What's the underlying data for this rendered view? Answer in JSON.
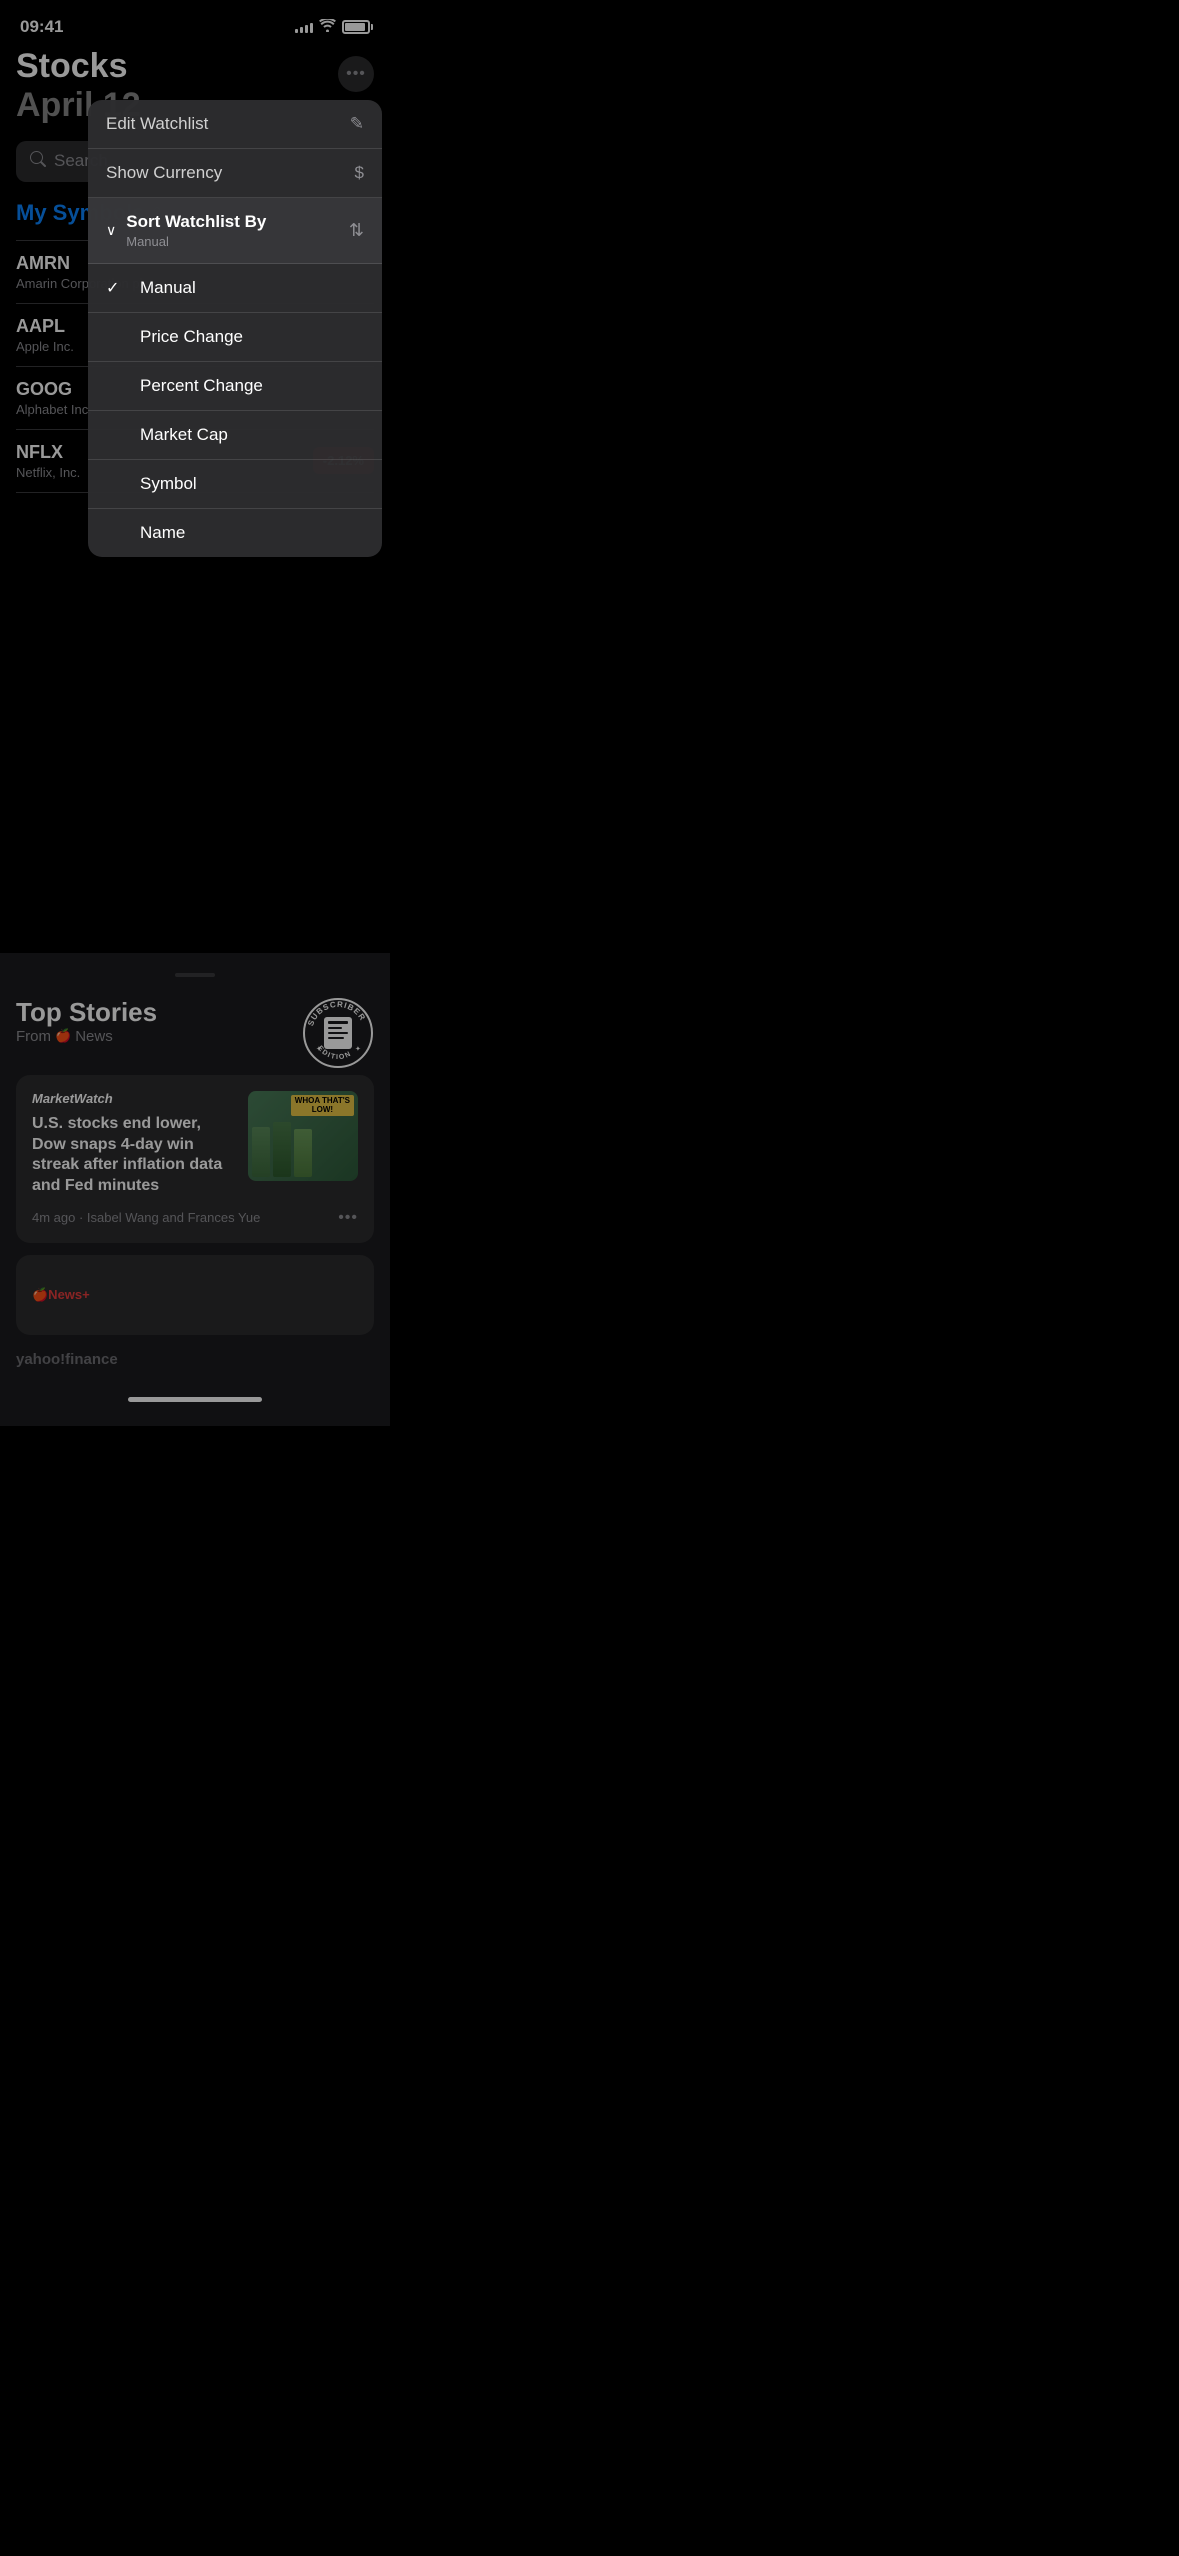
{
  "statusBar": {
    "time": "09:41",
    "signalBars": [
      4,
      6,
      8,
      10,
      12
    ],
    "batteryLevel": 90
  },
  "header": {
    "appTitle": "Stocks",
    "date": "April 12",
    "moreButtonLabel": "•••"
  },
  "search": {
    "placeholder": "Search"
  },
  "watchlist": {
    "label": "My Symbols",
    "stocks": [
      {
        "symbol": "AMRN",
        "name": "Amarin Corporation plc"
      },
      {
        "symbol": "AAPL",
        "name": "Apple Inc."
      },
      {
        "symbol": "GOOG",
        "name": "Alphabet Inc."
      },
      {
        "symbol": "NFLX",
        "name": "Netflix, Inc.",
        "badge": "-2.12%"
      }
    ]
  },
  "contextMenu": {
    "editWatchlist": "Edit Watchlist",
    "showCurrency": "Show Currency",
    "showCurrencyIcon": "$",
    "editIcon": "✎",
    "sortSection": {
      "title": "Sort Watchlist By",
      "current": "Manual"
    },
    "options": [
      {
        "label": "Manual",
        "selected": true
      },
      {
        "label": "Price Change",
        "selected": false
      },
      {
        "label": "Percent Change",
        "selected": false
      },
      {
        "label": "Market Cap",
        "selected": false
      },
      {
        "label": "Symbol",
        "selected": false
      },
      {
        "label": "Name",
        "selected": false
      }
    ]
  },
  "topStories": {
    "title": "Top Stories",
    "from": "From",
    "newsSource": "News",
    "subscriberBadge": "SUBSCRIBER\nEDITION",
    "articles": [
      {
        "source": "MarketWatch",
        "headline": "U.S. stocks end lower, Dow snaps 4-day win streak after inflation data and Fed minutes",
        "time": "4m ago",
        "authors": "Isabel Wang and Frances Yue",
        "thumbnail": {
          "badge1": "WHOA THAT'S",
          "badge2": "LOW!"
        }
      }
    ],
    "newsPlus": "News+"
  },
  "yahooFinance": {
    "label": "yahoo!finance"
  },
  "colors": {
    "accent": "#0a84ff",
    "negative": "#d32f2f",
    "background": "#000000",
    "surface": "#1c1c1e",
    "card": "#2c2c2e",
    "text": "#ffffff",
    "secondaryText": "#8e8e93"
  }
}
